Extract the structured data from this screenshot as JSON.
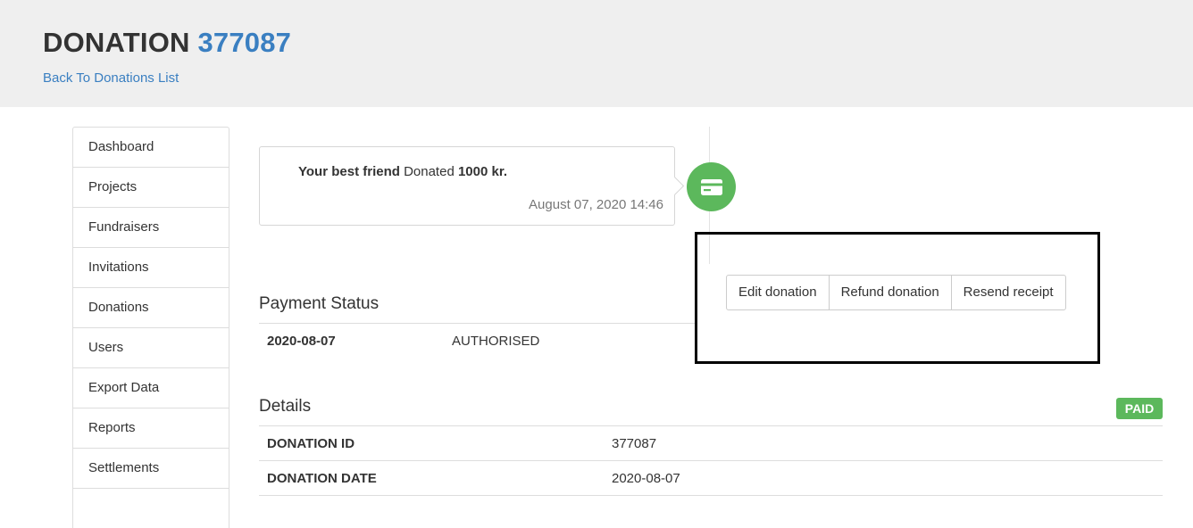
{
  "header": {
    "title_prefix": "DONATION",
    "donation_number": "377087",
    "back_link": "Back To Donations List"
  },
  "sidebar": {
    "items": [
      {
        "label": "Dashboard"
      },
      {
        "label": "Projects"
      },
      {
        "label": "Fundraisers"
      },
      {
        "label": "Invitations"
      },
      {
        "label": "Donations"
      },
      {
        "label": "Users"
      },
      {
        "label": "Export Data"
      },
      {
        "label": "Reports"
      },
      {
        "label": "Settlements"
      },
      {
        "label": ""
      }
    ]
  },
  "timeline": {
    "donor": "Your best friend",
    "action": " Donated ",
    "amount": "1000 kr.",
    "date": "August 07, 2020 14:46",
    "icon": "credit-card-icon",
    "badge_color": "#5cb85c"
  },
  "actions": {
    "edit": "Edit donation",
    "refund": "Refund donation",
    "resend": "Resend receipt"
  },
  "payment_status": {
    "title": "Payment Status",
    "rows": [
      {
        "date": "2020-08-07",
        "status": "AUTHORISED"
      }
    ]
  },
  "details": {
    "title": "Details",
    "badge": "PAID",
    "badge_color": "#5cb85c",
    "rows": [
      {
        "label": "DONATION ID",
        "value": "377087"
      },
      {
        "label": "DONATION DATE",
        "value": "2020-08-07"
      }
    ]
  },
  "colors": {
    "link": "#3a7fc1",
    "header_bg": "#efefef"
  }
}
